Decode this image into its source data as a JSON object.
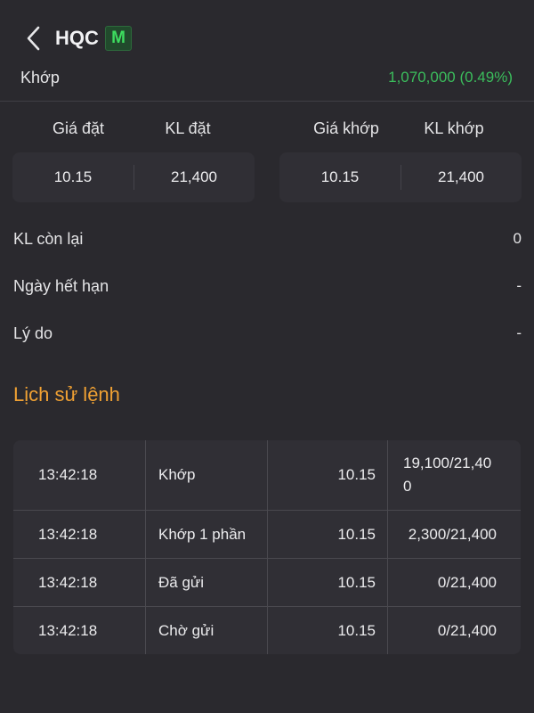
{
  "header": {
    "ticker": "HQC",
    "badge": "M"
  },
  "status": {
    "label": "Khớp",
    "value": "1,070,000 (0.49%)",
    "value_color": "#3bbd5c"
  },
  "order_columns": {
    "order_price_label": "Giá đặt",
    "order_qty_label": "KL đặt",
    "match_price_label": "Giá khớp",
    "match_qty_label": "KL khớp"
  },
  "order_values": {
    "order_price": "10.15",
    "order_qty": "21,400",
    "match_price": "10.15",
    "match_qty": "21,400"
  },
  "details": [
    {
      "label": "KL còn lại",
      "value": "0"
    },
    {
      "label": "Ngày hết hạn",
      "value": "-"
    },
    {
      "label": "Lý do",
      "value": "-"
    }
  ],
  "history": {
    "title": "Lịch sử lệnh",
    "title_color": "#f0a133",
    "rows": [
      {
        "time": "13:42:18",
        "status": "Khớp",
        "price": "10.15",
        "qty": "19,100/21,400"
      },
      {
        "time": "13:42:18",
        "status": "Khớp 1 phần",
        "price": "10.15",
        "qty": "2,300/21,400"
      },
      {
        "time": "13:42:18",
        "status": "Đã gửi",
        "price": "10.15",
        "qty": "0/21,400"
      },
      {
        "time": "13:42:18",
        "status": "Chờ gửi",
        "price": "10.15",
        "qty": "0/21,400"
      }
    ]
  },
  "icons": {
    "back": "chevron-left-icon"
  }
}
